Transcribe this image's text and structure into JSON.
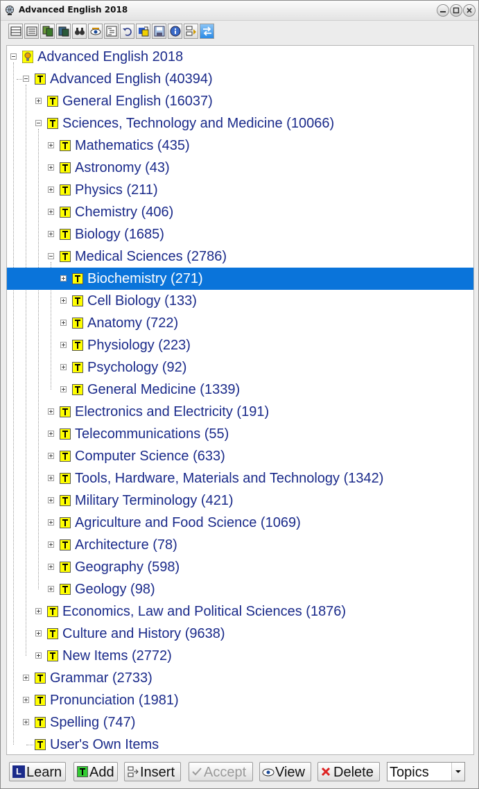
{
  "window": {
    "title": "Advanced English 2018"
  },
  "tree": {
    "root": "Advanced English 2018",
    "n1": "Advanced English (40394)",
    "n2": "General English (16037)",
    "n3": "Sciences, Technology and Medicine (10066)",
    "n4": "Mathematics (435)",
    "n5": "Astronomy (43)",
    "n6": "Physics (211)",
    "n7": "Chemistry (406)",
    "n8": "Biology (1685)",
    "n9": "Medical Sciences (2786)",
    "n10": "Biochemistry (271)",
    "n11": "Cell Biology (133)",
    "n12": "Anatomy (722)",
    "n13": "Physiology (223)",
    "n14": "Psychology (92)",
    "n15": "General Medicine (1339)",
    "n16": "Electronics and Electricity (191)",
    "n17": "Telecommunications (55)",
    "n18": "Computer Science (633)",
    "n19": "Tools, Hardware, Materials and Technology (1342)",
    "n20": "Military Terminology (421)",
    "n21": "Agriculture and Food Science (1069)",
    "n22": "Architecture (78)",
    "n23": "Geography (598)",
    "n24": "Geology (98)",
    "n25": "Economics, Law and Political Sciences (1876)",
    "n26": "Culture and History (9638)",
    "n27": "New Items (2772)",
    "n28": "Grammar (2733)",
    "n29": "Pronunciation (1981)",
    "n30": "Spelling (747)",
    "n31": "User's Own Items"
  },
  "bottom": {
    "learn": "Learn",
    "learn_key": "L",
    "add": "Add",
    "insert": "Insert",
    "accept": "Accept",
    "view": "View",
    "delete": "Delete",
    "mode": "Topics"
  },
  "colors": {
    "selection": "#0a74da",
    "label": "#1a2a8a",
    "topic_icon": "#ffff00"
  }
}
